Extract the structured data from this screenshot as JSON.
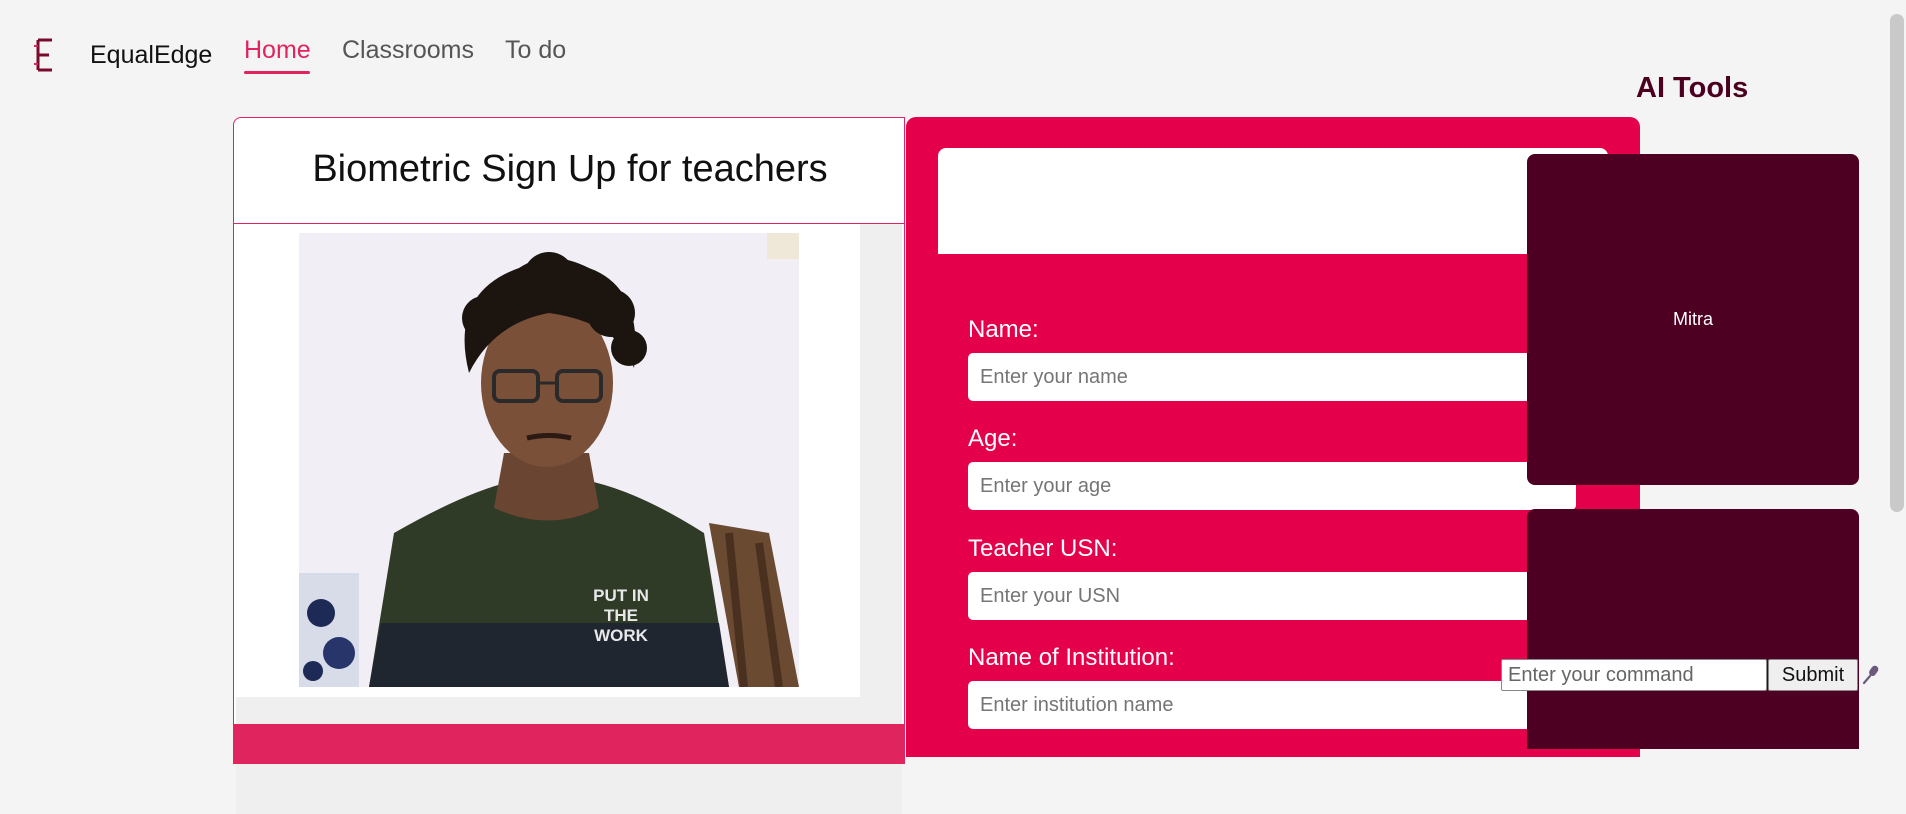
{
  "nav": {
    "brand": "EqualEdge",
    "logo_icon": "E-logo-icon",
    "links": [
      {
        "label": "Home",
        "active": true
      },
      {
        "label": "Classrooms",
        "active": false
      },
      {
        "label": "To do",
        "active": false
      }
    ]
  },
  "signup": {
    "title": "Biometric Sign Up for teachers",
    "camera_view": "webcam-feed"
  },
  "form": {
    "fields": [
      {
        "label": "Name:",
        "placeholder": "Enter your name"
      },
      {
        "label": "Age:",
        "placeholder": "Enter your age"
      },
      {
        "label": "Teacher USN:",
        "placeholder": "Enter your USN"
      },
      {
        "label": "Name of Institution:",
        "placeholder": "Enter institution name"
      }
    ]
  },
  "ai_tools": {
    "title": "AI Tools",
    "tools": [
      {
        "label": "Mitra"
      },
      {
        "label": ""
      }
    ],
    "command_placeholder": "Enter your command",
    "submit_label": "Submit",
    "mic_icon": "microphone-icon"
  },
  "colors": {
    "accent": "#e0245e",
    "form_bg": "#e4004b",
    "tool_bg": "#4e0022",
    "title_dark": "#4b0020"
  }
}
